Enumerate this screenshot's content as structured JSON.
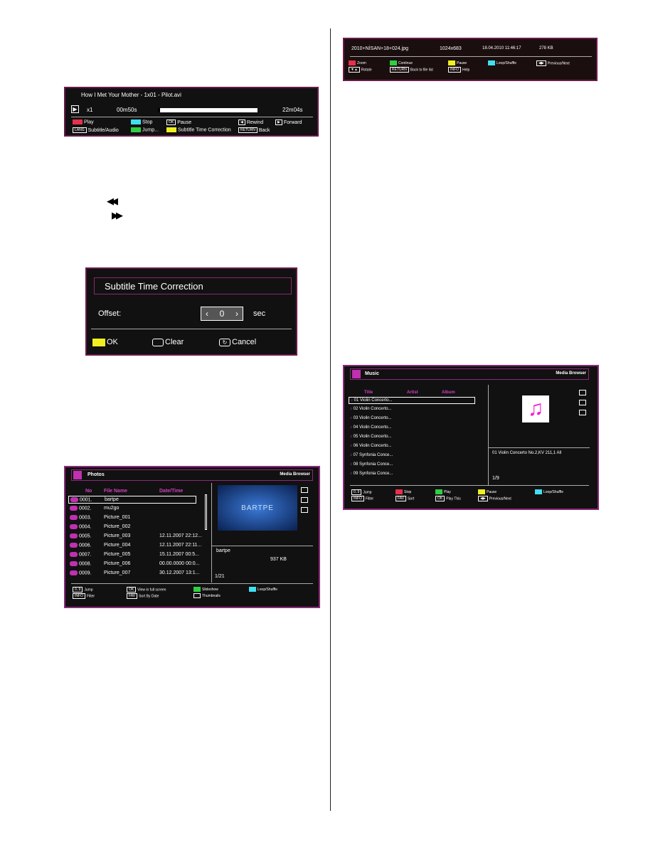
{
  "video_bar": {
    "title": "How I Met Your Mother - 1x01 - Pilot.avi",
    "speed": "x1",
    "elapsed": "00m50s",
    "total": "22m04s",
    "progress_pct": 4,
    "legend": [
      {
        "key": "red",
        "label": "Play"
      },
      {
        "key": "cyan",
        "label": "Stop"
      },
      {
        "key": "OK",
        "label": "Pause"
      },
      {
        "key": "◀",
        "label": "Rewind"
      },
      {
        "key": "▶",
        "label": "Forward"
      },
      {
        "key": "LANG",
        "label": "Subtitle/Audio"
      },
      {
        "key": "green",
        "label": "Jump..."
      },
      {
        "key": "yellow",
        "label": "Subtitle Time Correction"
      },
      {
        "key": "RETURN",
        "label": "Back"
      }
    ]
  },
  "rewind_icon": "◀◀",
  "forward_icon": "▶▶",
  "subtitle_dialog": {
    "title": "Subtitle Time Correction",
    "offset_label": "Offset:",
    "offset_value": "0",
    "unit": "sec",
    "ok": "OK",
    "clear": "Clear",
    "cancel": "Cancel"
  },
  "photos": {
    "title": "Photos",
    "browser": "Media Browser",
    "headers": [
      "No",
      "File Name",
      "Date/Time"
    ],
    "rows": [
      [
        "0001.",
        "bartpe",
        ""
      ],
      [
        "0002.",
        "mu2go",
        ""
      ],
      [
        "0003.",
        "Picture_001",
        ""
      ],
      [
        "0004.",
        "Picture_002",
        ""
      ],
      [
        "0005.",
        "Picture_003",
        "12.11.2007 22:12..."
      ],
      [
        "0006.",
        "Picture_004",
        "12.11.2007 22:11..."
      ],
      [
        "0007.",
        "Picture_005",
        "15.11.2007 00:5..."
      ],
      [
        "0008.",
        "Picture_006",
        "00.00.0000 00:0..."
      ],
      [
        "0009.",
        "Picture_007",
        "30.12.2007 13:1..."
      ]
    ],
    "preview_text": "BARTPE",
    "info_name": "bartpe",
    "info_size": "937 KB",
    "page": "1/21",
    "legend": [
      {
        "key": "0..9",
        "label": "Jump"
      },
      {
        "key": "OK",
        "label": "View in full screen"
      },
      {
        "key": "green",
        "label": "Slideshow"
      },
      {
        "key": "cyan",
        "label": "Loop/Shuffle"
      },
      {
        "key": "INFO",
        "label": "Filter"
      },
      {
        "key": "FAV",
        "label": "Sort By Date"
      },
      {
        "key": "thumb",
        "label": "Thumbnails"
      }
    ]
  },
  "photo_bar": {
    "file": "2010+NİSAN+18+024.jpg",
    "resolution": "1024x683",
    "date": "18.04.2010 11:46:17",
    "size": "278 KB",
    "legend": [
      {
        "key": "red",
        "label": "Zoom"
      },
      {
        "key": "green",
        "label": "Continue"
      },
      {
        "key": "yellow",
        "label": "Pause"
      },
      {
        "key": "cyan",
        "label": "Loop/Shuffle"
      },
      {
        "key": "◀▶",
        "label": "Previous/Next"
      },
      {
        "key": "▼▲",
        "label": "Rotate"
      },
      {
        "key": "RETURN",
        "label": "Back to file list"
      },
      {
        "key": "INFO",
        "label": "Help"
      }
    ]
  },
  "music": {
    "title": "Music",
    "browser": "Media Browser",
    "headers": [
      "Title",
      "Artist",
      "Album"
    ],
    "rows": [
      "01 Violin Concerto...",
      "02 Violin Concerto...",
      "03 Violin Concerto...",
      "04 Violin Concerto...",
      "05 Violin Concerto...",
      "06 Violin Concerto...",
      "07 Synfonia Conce...",
      "08 Synfonia Conce...",
      "09 Synfonia Conce..."
    ],
    "info": "01 Violin Concerto No.2,KV 211,1 All",
    "page": "1/9",
    "legend": [
      {
        "key": "0..9",
        "label": "Jump"
      },
      {
        "key": "red",
        "label": "Stop"
      },
      {
        "key": "green",
        "label": "Play"
      },
      {
        "key": "yellow",
        "label": "Pause"
      },
      {
        "key": "cyan",
        "label": "Loop/Shuffle"
      },
      {
        "key": "INFO",
        "label": "Filter"
      },
      {
        "key": "FAV",
        "label": "Sort"
      },
      {
        "key": "OK",
        "label": "Play This"
      },
      {
        "key": "◀▶",
        "label": "Previous/Next"
      }
    ]
  },
  "colors": {
    "red": "#e8304a",
    "green": "#30d040",
    "yellow": "#f0f020",
    "cyan": "#40e0f0",
    "accent": "#d040c0"
  }
}
